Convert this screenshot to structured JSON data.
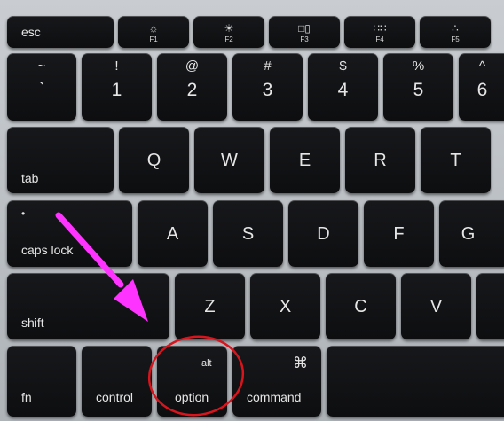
{
  "fn_row": {
    "esc": "esc",
    "keys": [
      {
        "icon": "☼",
        "label": "F1"
      },
      {
        "icon": "☀",
        "label": "F2"
      },
      {
        "icon": "□▯",
        "label": "F3"
      },
      {
        "icon": "∷∷",
        "label": "F4"
      },
      {
        "icon": "∴",
        "label": "F5"
      }
    ]
  },
  "number_row": [
    {
      "top": "~",
      "bottom": "`"
    },
    {
      "top": "!",
      "bottom": "1"
    },
    {
      "top": "@",
      "bottom": "2"
    },
    {
      "top": "#",
      "bottom": "3"
    },
    {
      "top": "$",
      "bottom": "4"
    },
    {
      "top": "%",
      "bottom": "5"
    },
    {
      "top": "^",
      "bottom": "6"
    }
  ],
  "tab_row": {
    "tab": "tab",
    "letters": [
      "Q",
      "W",
      "E",
      "R",
      "T"
    ]
  },
  "caps_row": {
    "dot": "•",
    "caps": "caps lock",
    "letters": [
      "A",
      "S",
      "D",
      "F",
      "G"
    ]
  },
  "shift_row": {
    "shift": "shift",
    "letters": [
      "Z",
      "X",
      "C",
      "V"
    ]
  },
  "bottom_row": {
    "fn": "fn",
    "control": "control",
    "option_alt": "alt",
    "option": "option",
    "command_symbol": "⌘",
    "command": "command"
  },
  "annotation": {
    "arrow_color": "#ff33ff",
    "circle_color": "#d8141c"
  }
}
